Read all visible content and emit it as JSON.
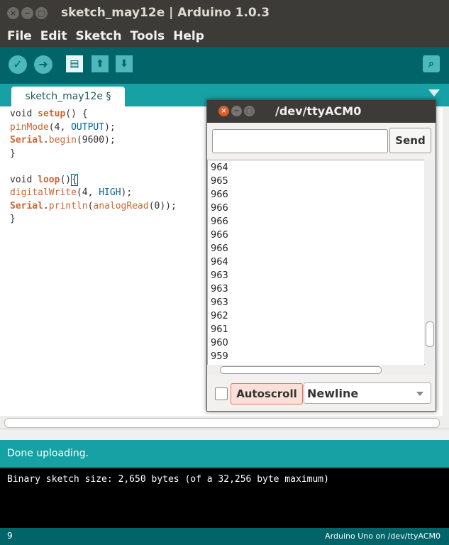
{
  "window": {
    "title": "sketch_may12e | Arduino 1.0.3"
  },
  "menu": [
    "File",
    "Edit",
    "Sketch",
    "Tools",
    "Help"
  ],
  "toolbar": {
    "verify_icon": "check-icon",
    "upload_icon": "arrow-right-icon",
    "new_icon": "new-document-icon",
    "open_icon": "open-up-arrow-icon",
    "save_icon": "save-down-arrow-icon",
    "serial_monitor_icon": "magnifier-icon"
  },
  "tab": {
    "label": "sketch_may12e §"
  },
  "code": {
    "line1": {
      "pre": "void ",
      "fn": "setup",
      "post": "() {"
    },
    "line2": {
      "fn": "pinMode",
      "args_pre": "(4, ",
      "const": "OUTPUT",
      "args_post": ");"
    },
    "line3": {
      "obj": "Serial",
      "dot": ".",
      "fn": "begin",
      "args": "(9600);"
    },
    "line4": "}",
    "line6": {
      "pre": "void ",
      "fn": "loop",
      "post": "()",
      "brace": "{"
    },
    "line7": {
      "fn": "digitalWrite",
      "args_pre": "(4, ",
      "const": "HIGH",
      "args_post": ");"
    },
    "line8": {
      "obj": "Serial",
      "dot": ".",
      "fn": "println",
      "open": "(",
      "inner": "analogRead",
      "args": "(0));"
    },
    "line9": "}"
  },
  "serial_monitor": {
    "title": "/dev/ttyACM0",
    "send_label": "Send",
    "input_value": "",
    "output": [
      "964",
      "965",
      "966",
      "966",
      "966",
      "966",
      "966",
      "964",
      "963",
      "963",
      "963",
      "962",
      "961",
      "960",
      "959"
    ],
    "autoscroll_label": "Autoscroll",
    "autoscroll_checked": false,
    "line_ending": "Newline"
  },
  "status": {
    "message": "Done uploading."
  },
  "console": {
    "text": "Binary sketch size: 2,650 bytes (of a 32,256 byte maximum)"
  },
  "footer": {
    "line_number": "9",
    "board": "Arduino Uno on /dev/ttyACM0"
  }
}
